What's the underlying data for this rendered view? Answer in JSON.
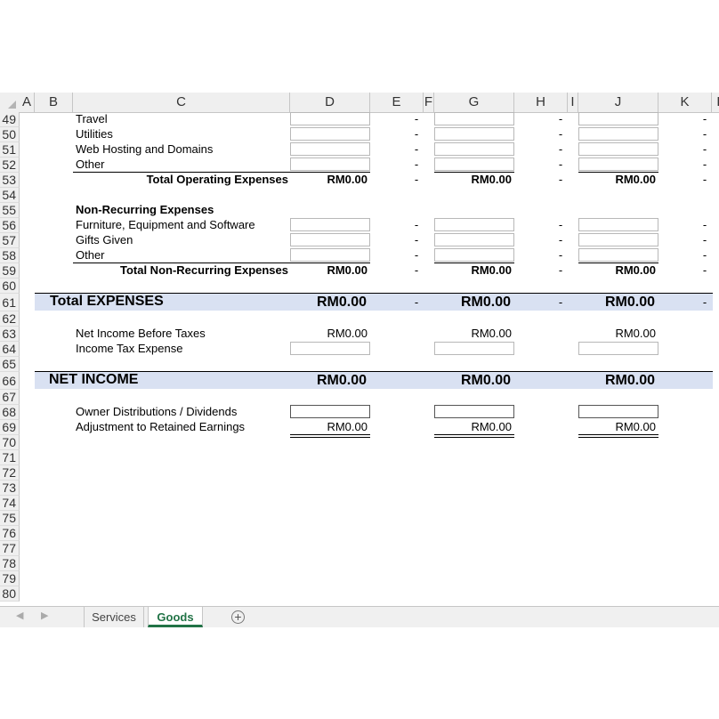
{
  "columns": [
    "A",
    "B",
    "C",
    "D",
    "E",
    "F",
    "G",
    "H",
    "I",
    "J",
    "K",
    "L"
  ],
  "rows": [
    "49",
    "50",
    "51",
    "52",
    "53",
    "54",
    "55",
    "56",
    "57",
    "58",
    "59",
    "60",
    "61",
    "62",
    "63",
    "64",
    "65",
    "66",
    "67",
    "68",
    "69",
    "70",
    "71",
    "72",
    "73",
    "74",
    "75",
    "76",
    "77",
    "78",
    "79",
    "80"
  ],
  "labels": {
    "travel": "Travel",
    "utilities": "Utilities",
    "web_hosting": "Web Hosting and Domains",
    "other_op": "Other",
    "total_operating": "Total Operating Expenses",
    "non_recurring_header": "Non-Recurring Expenses",
    "furniture": "Furniture, Equipment and Software",
    "gifts": "Gifts Given",
    "other_nr": "Other",
    "total_non_recurring": "Total Non-Recurring Expenses",
    "total_expenses": "Total EXPENSES",
    "net_income_before_taxes": "Net Income Before Taxes",
    "income_tax": "Income Tax Expense",
    "net_income": "NET INCOME",
    "owner_distributions": "Owner Distributions / Dividends",
    "adjustment": "Adjustment to Retained Earnings"
  },
  "values": {
    "total_operating": [
      "RM0.00",
      "RM0.00",
      "RM0.00"
    ],
    "total_non_recurring": [
      "RM0.00",
      "RM0.00",
      "RM0.00"
    ],
    "total_expenses": [
      "RM0.00",
      "RM0.00",
      "RM0.00"
    ],
    "net_income_before_taxes": [
      "RM0.00",
      "RM0.00",
      "RM0.00"
    ],
    "net_income": [
      "RM0.00",
      "RM0.00",
      "RM0.00"
    ],
    "adjustment": [
      "RM0.00",
      "RM0.00",
      "RM0.00"
    ]
  },
  "dash": "-",
  "tabs": {
    "services": "Services",
    "goods": "Goods",
    "add_icon": "+",
    "prev_icon": "◀",
    "next_icon": "▶"
  },
  "colors": {
    "band": "#d9e1f2",
    "active_tab": "#217346"
  }
}
